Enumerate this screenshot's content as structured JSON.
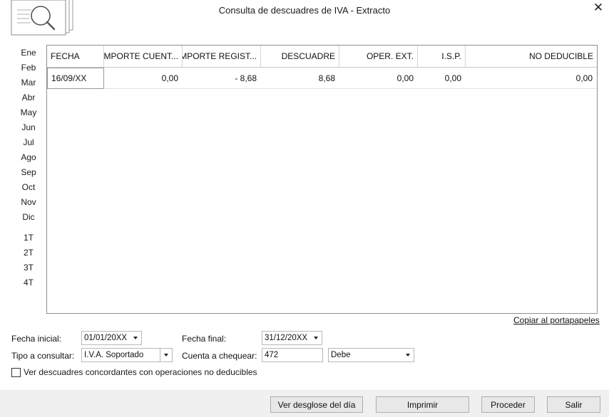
{
  "window": {
    "title": "Consulta de descuadres de IVA - Extracto",
    "close_glyph": "✕"
  },
  "periods": {
    "months": [
      "Ene",
      "Feb",
      "Mar",
      "Abr",
      "May",
      "Jun",
      "Jul",
      "Ago",
      "Sep",
      "Oct",
      "Nov",
      "Dic"
    ],
    "quarters": [
      "1T",
      "2T",
      "3T",
      "4T"
    ]
  },
  "table": {
    "columns": [
      "FECHA",
      "IMPORTE CUENT...",
      "IMPORTE REGIST...",
      "DESCUADRE",
      "OPER. EXT.",
      "I.S.P.",
      "NO DEDUCIBLE"
    ],
    "rows": [
      [
        "16/09/XX",
        "0,00",
        "- 8,68",
        "8,68",
        "0,00",
        "0,00",
        "0,00"
      ]
    ]
  },
  "copy_link": "Copiar al portapapeles",
  "filters": {
    "fecha_inicial_label": "Fecha inicial:",
    "fecha_inicial_value": "01/01/20XX",
    "fecha_final_label": "Fecha final:",
    "fecha_final_value": "31/12/20XX",
    "tipo_label": "Tipo a consultar:",
    "tipo_value": "I.V.A. Soportado",
    "cuenta_label": "Cuenta a chequear:",
    "cuenta_value": "472",
    "debe_value": "Debe",
    "checkbox_label": "Ver descuadres concordantes con operaciones no deducibles",
    "checkbox_checked": false
  },
  "buttons": {
    "desglose": "Ver desglose del día",
    "imprimir": "Imprimir",
    "proceder": "Proceder",
    "salir": "Salir"
  },
  "icons": {
    "logo": "magnifier-documents-icon",
    "close": "close-icon"
  }
}
